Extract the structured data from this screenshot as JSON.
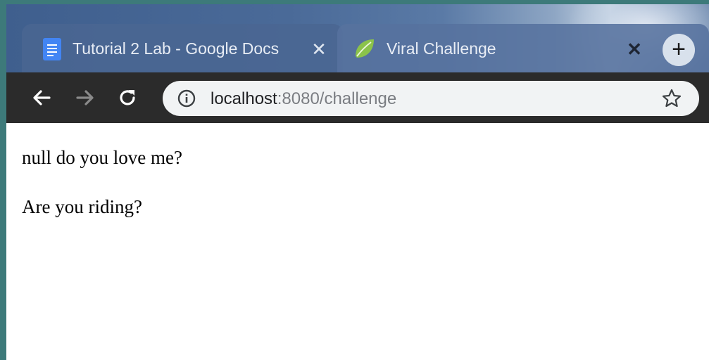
{
  "tabs": [
    {
      "title": "Tutorial 2 Lab - Google Docs",
      "icon": "google-docs-icon",
      "active": false
    },
    {
      "title": "Viral Challenge",
      "icon": "spring-leaf-icon",
      "active": true
    }
  ],
  "omnibox": {
    "host": "localhost",
    "rest": ":8080/challenge"
  },
  "content": {
    "line1": "null do you love me?",
    "line2": "Are you riding?"
  },
  "colors": {
    "toolbar": "#2b2b2b",
    "omnibox": "#f1f3f4",
    "docs_blue": "#4285f4",
    "spring_green": "#8bc34a"
  }
}
